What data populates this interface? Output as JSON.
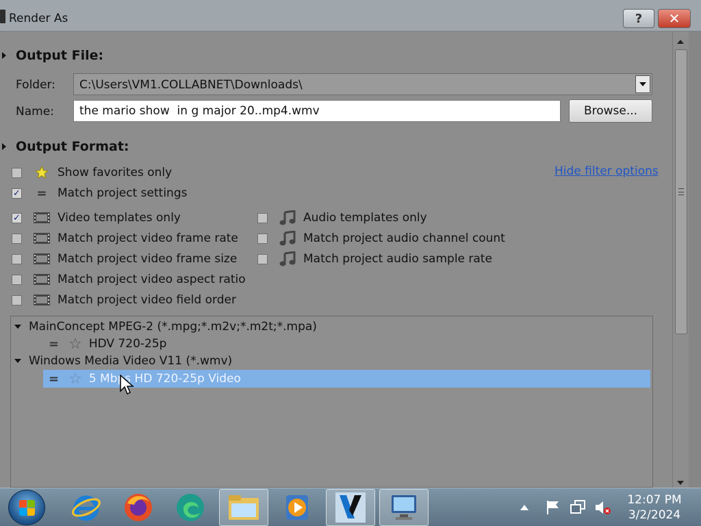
{
  "window": {
    "title": "Render As"
  },
  "output_file": {
    "heading": "Output File:",
    "folder_label": "Folder:",
    "folder_value": "C:\\Users\\VM1.COLLABNET\\Downloads\\",
    "name_label": "Name:",
    "name_value": "the mario show  in g major 20..mp4.wmv",
    "browse_label": "Browse..."
  },
  "output_format": {
    "heading": "Output Format:",
    "hide_filter_link": "Hide filter options",
    "options": {
      "show_favorites": {
        "label": "Show favorites only",
        "checked": false
      },
      "match_project_settings": {
        "label": "Match project settings",
        "checked": true
      },
      "video_templates_only": {
        "label": "Video templates only",
        "checked": true
      },
      "match_video_frame_rate": {
        "label": "Match project video frame rate",
        "checked": false
      },
      "match_video_frame_size": {
        "label": "Match project video frame size",
        "checked": false
      },
      "match_video_aspect_ratio": {
        "label": "Match project video aspect ratio",
        "checked": false
      },
      "match_video_field_order": {
        "label": "Match project video field order",
        "checked": false
      },
      "audio_templates_only": {
        "label": "Audio templates only",
        "checked": false
      },
      "match_audio_channel_count": {
        "label": "Match project audio channel count",
        "checked": false
      },
      "match_audio_sample_rate": {
        "label": "Match project audio sample rate",
        "checked": false
      }
    }
  },
  "tree": {
    "groups": [
      {
        "label": "MainConcept MPEG-2 (*.mpg;*.m2v;*.m2t;*.mpa)",
        "items": [
          {
            "label": "HDV 720-25p",
            "selected": false
          }
        ]
      },
      {
        "label": "Windows Media Video V11 (*.wmv)",
        "items": [
          {
            "label": "5 Mbps HD 720-25p Video",
            "selected": true
          }
        ]
      }
    ]
  },
  "taskbar": {
    "apps": [
      "start-button",
      "internet-explorer-icon",
      "firefox-icon",
      "edge-icon",
      "file-explorer-icon",
      "media-player-icon",
      "vegas-pro-icon",
      "remote-desktop-icon"
    ],
    "clock_time": "12:07 PM",
    "clock_date": "3/2/2024"
  },
  "colors": {
    "selection": "#7fb0e6",
    "link": "#1f56c8",
    "close_button": "#c33d2a"
  }
}
